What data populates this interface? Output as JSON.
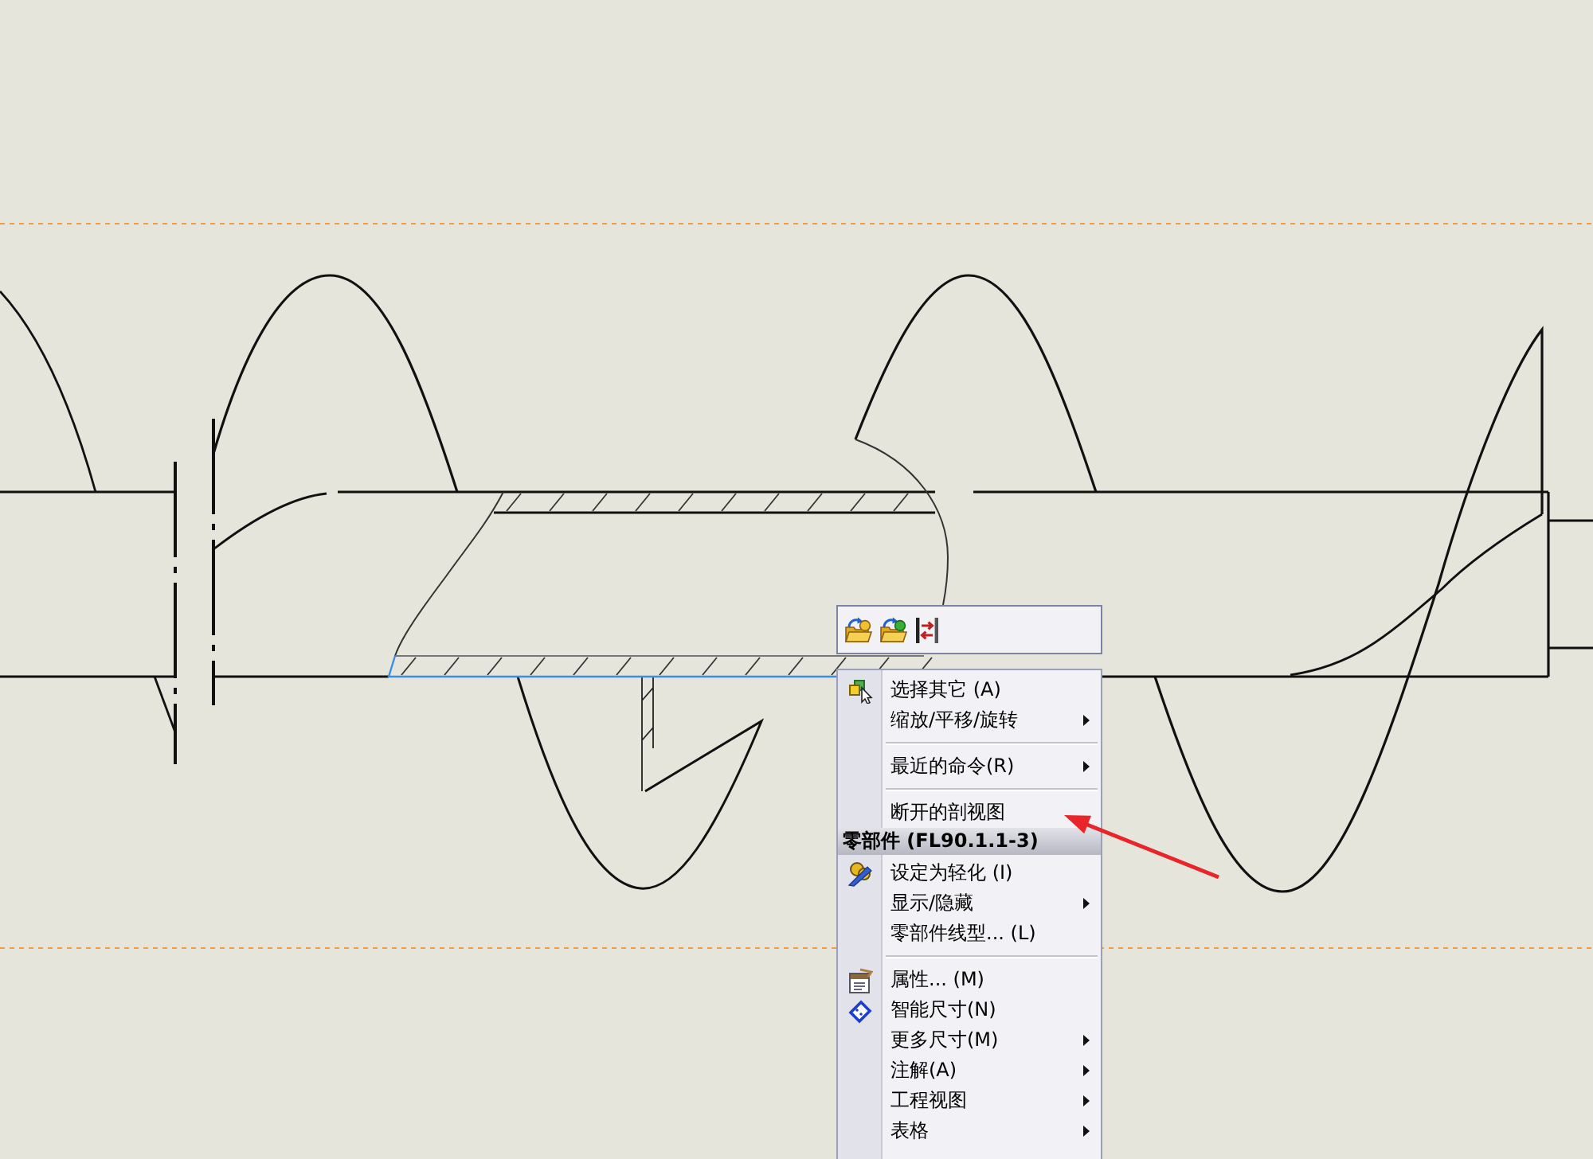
{
  "context_menu": {
    "items": [
      {
        "kind": "command",
        "label": "选择其它 (A)",
        "submenu": false
      },
      {
        "kind": "command",
        "label": "缩放/平移/旋转",
        "submenu": true
      },
      {
        "kind": "separator"
      },
      {
        "kind": "command",
        "label": "最近的命令(R)",
        "submenu": true
      },
      {
        "kind": "separator"
      },
      {
        "kind": "command",
        "label": "断开的剖视图",
        "submenu": false
      },
      {
        "kind": "header",
        "label": "零部件 (FL90.1.1-3)"
      },
      {
        "kind": "command",
        "label": "设定为轻化 (I)",
        "submenu": false
      },
      {
        "kind": "command",
        "label": "显示/隐藏",
        "submenu": true
      },
      {
        "kind": "command",
        "label": "零部件线型... (L)",
        "submenu": false
      },
      {
        "kind": "separator"
      },
      {
        "kind": "command",
        "label": "属性... (M)",
        "submenu": false
      },
      {
        "kind": "command",
        "label": "智能尺寸(N)",
        "submenu": false
      },
      {
        "kind": "command",
        "label": "更多尺寸(M)",
        "submenu": true
      },
      {
        "kind": "command",
        "label": "注解(A)",
        "submenu": true
      },
      {
        "kind": "command",
        "label": "工程视图",
        "submenu": true
      },
      {
        "kind": "command",
        "label": "表格",
        "submenu": true
      }
    ]
  }
}
